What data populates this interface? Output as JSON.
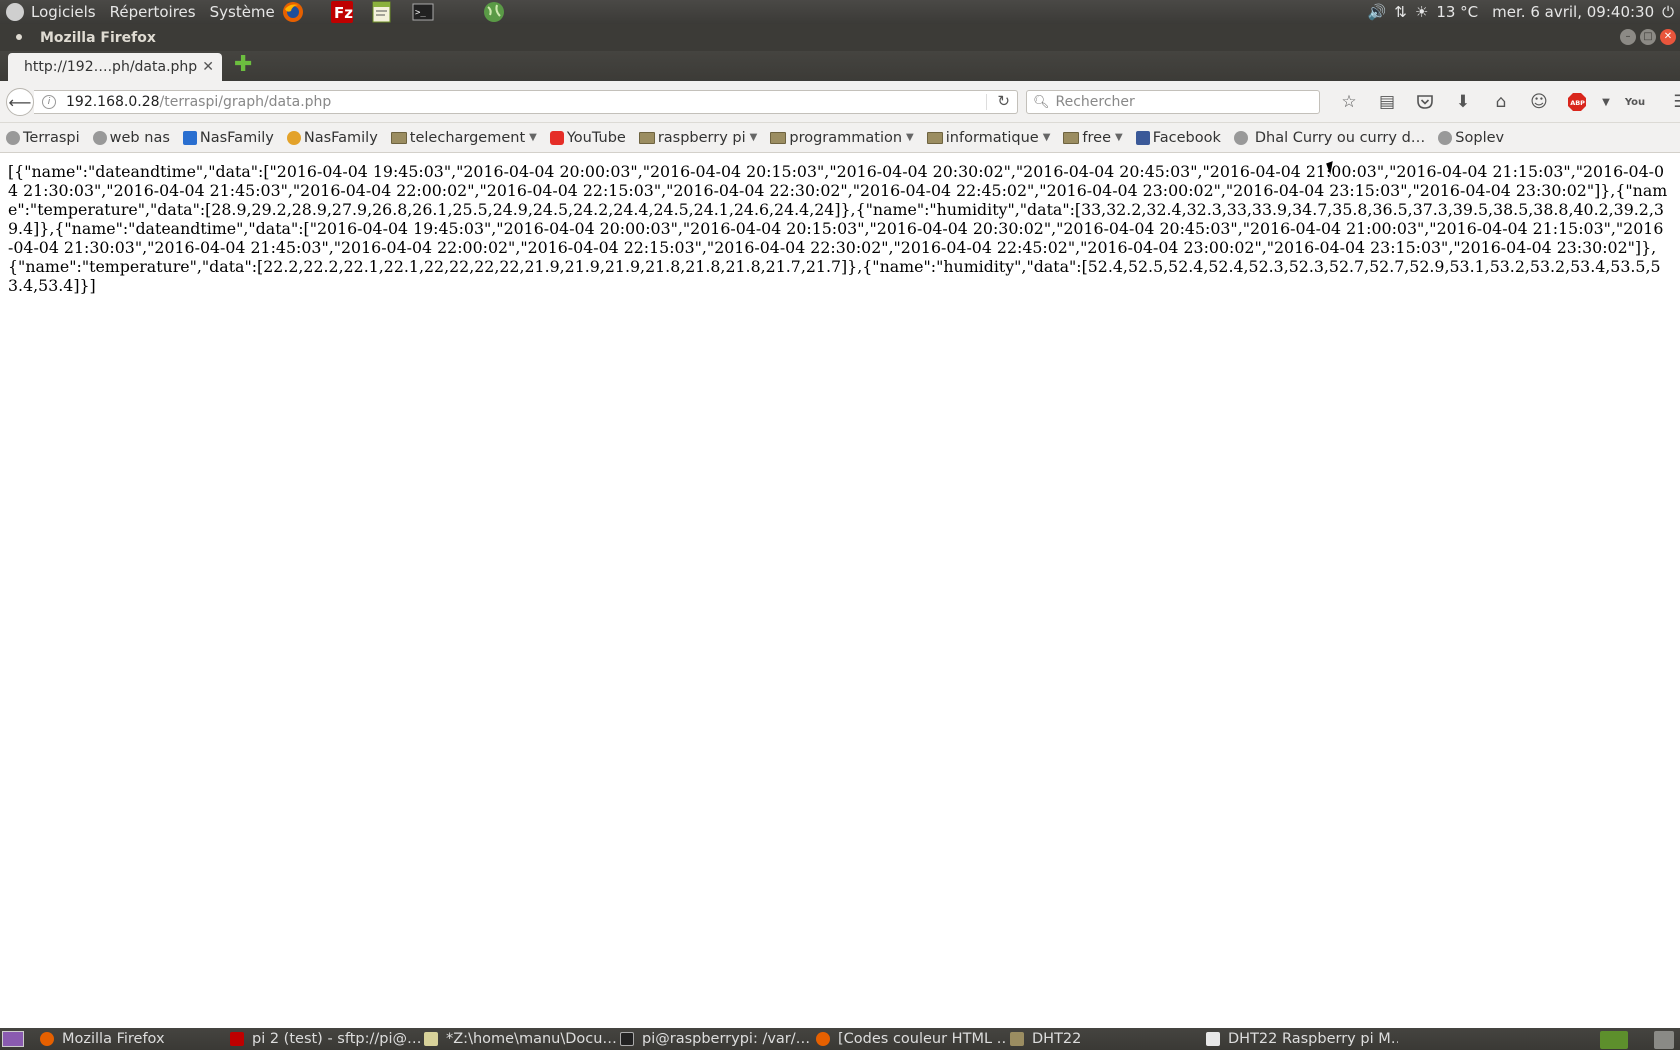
{
  "top_panel": {
    "menus": [
      "Logiciels",
      "Répertoires",
      "Système"
    ],
    "launchers": [
      "firefox-icon",
      "filezilla-icon",
      "text-editor-icon",
      "terminal-icon",
      "globe-icon"
    ],
    "indicators": {
      "weather": "13 °C",
      "clock": "mer. 6 avril, 09:40:30"
    }
  },
  "window": {
    "title": "Mozilla Firefox"
  },
  "tabs": [
    {
      "label": "http://192….ph/data.php",
      "active": true
    }
  ],
  "navbar": {
    "url_host": "192.168.0.28",
    "url_path": "/terraspi/graph/data.php",
    "search_placeholder": "Rechercher"
  },
  "bookmarks": [
    {
      "label": "Terraspi",
      "kind": "globe"
    },
    {
      "label": "web nas",
      "kind": "globe"
    },
    {
      "label": "NasFamily",
      "kind": "dsm"
    },
    {
      "label": "NasFamily",
      "kind": "family"
    },
    {
      "label": "telechargement",
      "kind": "folder",
      "dropdown": true
    },
    {
      "label": "YouTube",
      "kind": "youtube"
    },
    {
      "label": "raspberry pi",
      "kind": "folder",
      "dropdown": true
    },
    {
      "label": "programmation",
      "kind": "folder",
      "dropdown": true
    },
    {
      "label": "informatique",
      "kind": "folder",
      "dropdown": true
    },
    {
      "label": "free",
      "kind": "folder",
      "dropdown": true
    },
    {
      "label": "Facebook",
      "kind": "facebook"
    },
    {
      "label": "Dhal Curry ou curry d…",
      "kind": "globe"
    },
    {
      "label": "Soplev",
      "kind": "globe"
    }
  ],
  "content": {
    "raw_json": "[{\"name\":\"dateandtime\",\"data\":[\"2016-04-04 19:45:03\",\"2016-04-04 20:00:03\",\"2016-04-04 20:15:03\",\"2016-04-04 20:30:02\",\"2016-04-04 20:45:03\",\"2016-04-04 21:00:03\",\"2016-04-04 21:15:03\",\"2016-04-04 21:30:03\",\"2016-04-04 21:45:03\",\"2016-04-04 22:00:02\",\"2016-04-04 22:15:03\",\"2016-04-04 22:30:02\",\"2016-04-04 22:45:02\",\"2016-04-04 23:00:02\",\"2016-04-04 23:15:03\",\"2016-04-04 23:30:02\"]},{\"name\":\"temperature\",\"data\":[28.9,29.2,28.9,27.9,26.8,26.1,25.5,24.9,24.5,24.2,24.4,24.5,24.1,24.6,24.4,24]},{\"name\":\"humidity\",\"data\":[33,32.2,32.4,32.3,33,33.9,34.7,35.8,36.5,37.3,39.5,38.5,38.8,40.2,39.2,39.4]},{\"name\":\"dateandtime\",\"data\":[\"2016-04-04 19:45:03\",\"2016-04-04 20:00:03\",\"2016-04-04 20:15:03\",\"2016-04-04 20:30:02\",\"2016-04-04 20:45:03\",\"2016-04-04 21:00:03\",\"2016-04-04 21:15:03\",\"2016-04-04 21:30:03\",\"2016-04-04 21:45:03\",\"2016-04-04 22:00:02\",\"2016-04-04 22:15:03\",\"2016-04-04 22:30:02\",\"2016-04-04 22:45:02\",\"2016-04-04 23:00:02\",\"2016-04-04 23:15:03\",\"2016-04-04 23:30:02\"]},{\"name\":\"temperature\",\"data\":[22.2,22.2,22.1,22.1,22,22,22,22,21.9,21.9,21.9,21.8,21.8,21.8,21.7,21.7]},{\"name\":\"humidity\",\"data\":[52.4,52.5,52.4,52.4,52.3,52.3,52.7,52.7,52.9,53.1,53.2,53.2,53.4,53.5,53.4,53.4]}]"
  },
  "taskbar": {
    "tasks": [
      {
        "label": "Mozilla Firefox",
        "icon": "firefox-icon"
      },
      {
        "label": "pi 2 (test) - sftp://pi@…",
        "icon": "filezilla-icon"
      },
      {
        "label": "*Z:\\home\\manu\\Docu…",
        "icon": "text-editor-icon"
      },
      {
        "label": "pi@raspberrypi: /var/…",
        "icon": "terminal-icon"
      },
      {
        "label": "[Codes couleur HTML …",
        "icon": "firefox-icon"
      },
      {
        "label": "DHT22",
        "icon": "folder-icon"
      },
      {
        "label": "DHT22 Raspberry pi M…",
        "icon": "document-icon"
      }
    ]
  },
  "colors": {
    "panel_bg": "#3c3b37",
    "toolbar_bg": "#f2f1f0",
    "new_tab_accent": "#6cbe3f",
    "abp_red": "#d9261c"
  }
}
